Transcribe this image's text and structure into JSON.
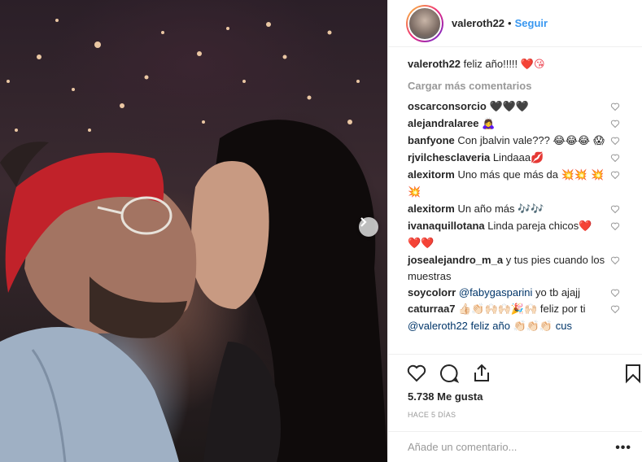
{
  "post": {
    "carousel_next_icon": "chevron-right-icon"
  },
  "header": {
    "username": "valeroth22",
    "separator": "•",
    "follow_label": "Seguir"
  },
  "caption": {
    "username": "valeroth22",
    "text": "feliz año!!!!!",
    "emojis": "❤️😘"
  },
  "load_more_label": "Cargar más comentarios",
  "comments": [
    {
      "username": "oscarconsorcio",
      "text": "",
      "emojis": "🖤🖤🖤"
    },
    {
      "username": "alejandralaree",
      "text": "",
      "emojis": "🙇‍♀️"
    },
    {
      "username": "banfyone",
      "text": "Con jbalvin vale???",
      "emojis": "😂😂😂 😱"
    },
    {
      "username": "rjvilchesclaveria",
      "text": "Lindaaa",
      "emojis": "💋"
    },
    {
      "username": "alexitorm",
      "text": "Uno más que más da",
      "emojis": "💥💥 💥💥"
    },
    {
      "username": "alexitorm",
      "text": "Un año más",
      "emojis": "🎶🎶"
    },
    {
      "username": "ivanaquillotana",
      "text": "Linda pareja chicos",
      "emojis": "❤️ ❤️❤️"
    },
    {
      "username": "josealejandro_m_a",
      "text": "y tus pies cuando los muestras",
      "emojis": ""
    },
    {
      "username": "soycolorr",
      "mention": "@fabygasparini",
      "text": "yo tb ajajj",
      "emojis": ""
    },
    {
      "username": "caturraa7",
      "text": "feliz por ti",
      "emojis": "👍🏻👏🏻🙌🏻🙌🏻🎉🙌🏻",
      "overflow_text": "@valeroth22 feliz año 👏🏻👏🏻👏🏻 cus"
    }
  ],
  "actions": {
    "like_icon": "heart-outline-icon",
    "comment_icon": "comment-bubble-icon",
    "share_icon": "share-upload-icon",
    "save_icon": "bookmark-icon"
  },
  "likes_text": "5.738 Me gusta",
  "timestamp": "HACE 5 DÍAS",
  "add_comment": {
    "placeholder": "Añade un comentario...",
    "more_label": "•••"
  },
  "colors": {
    "link_blue": "#3897f0",
    "muted_gray": "#999999",
    "border": "#efefef",
    "like_red": "#ed4956"
  }
}
